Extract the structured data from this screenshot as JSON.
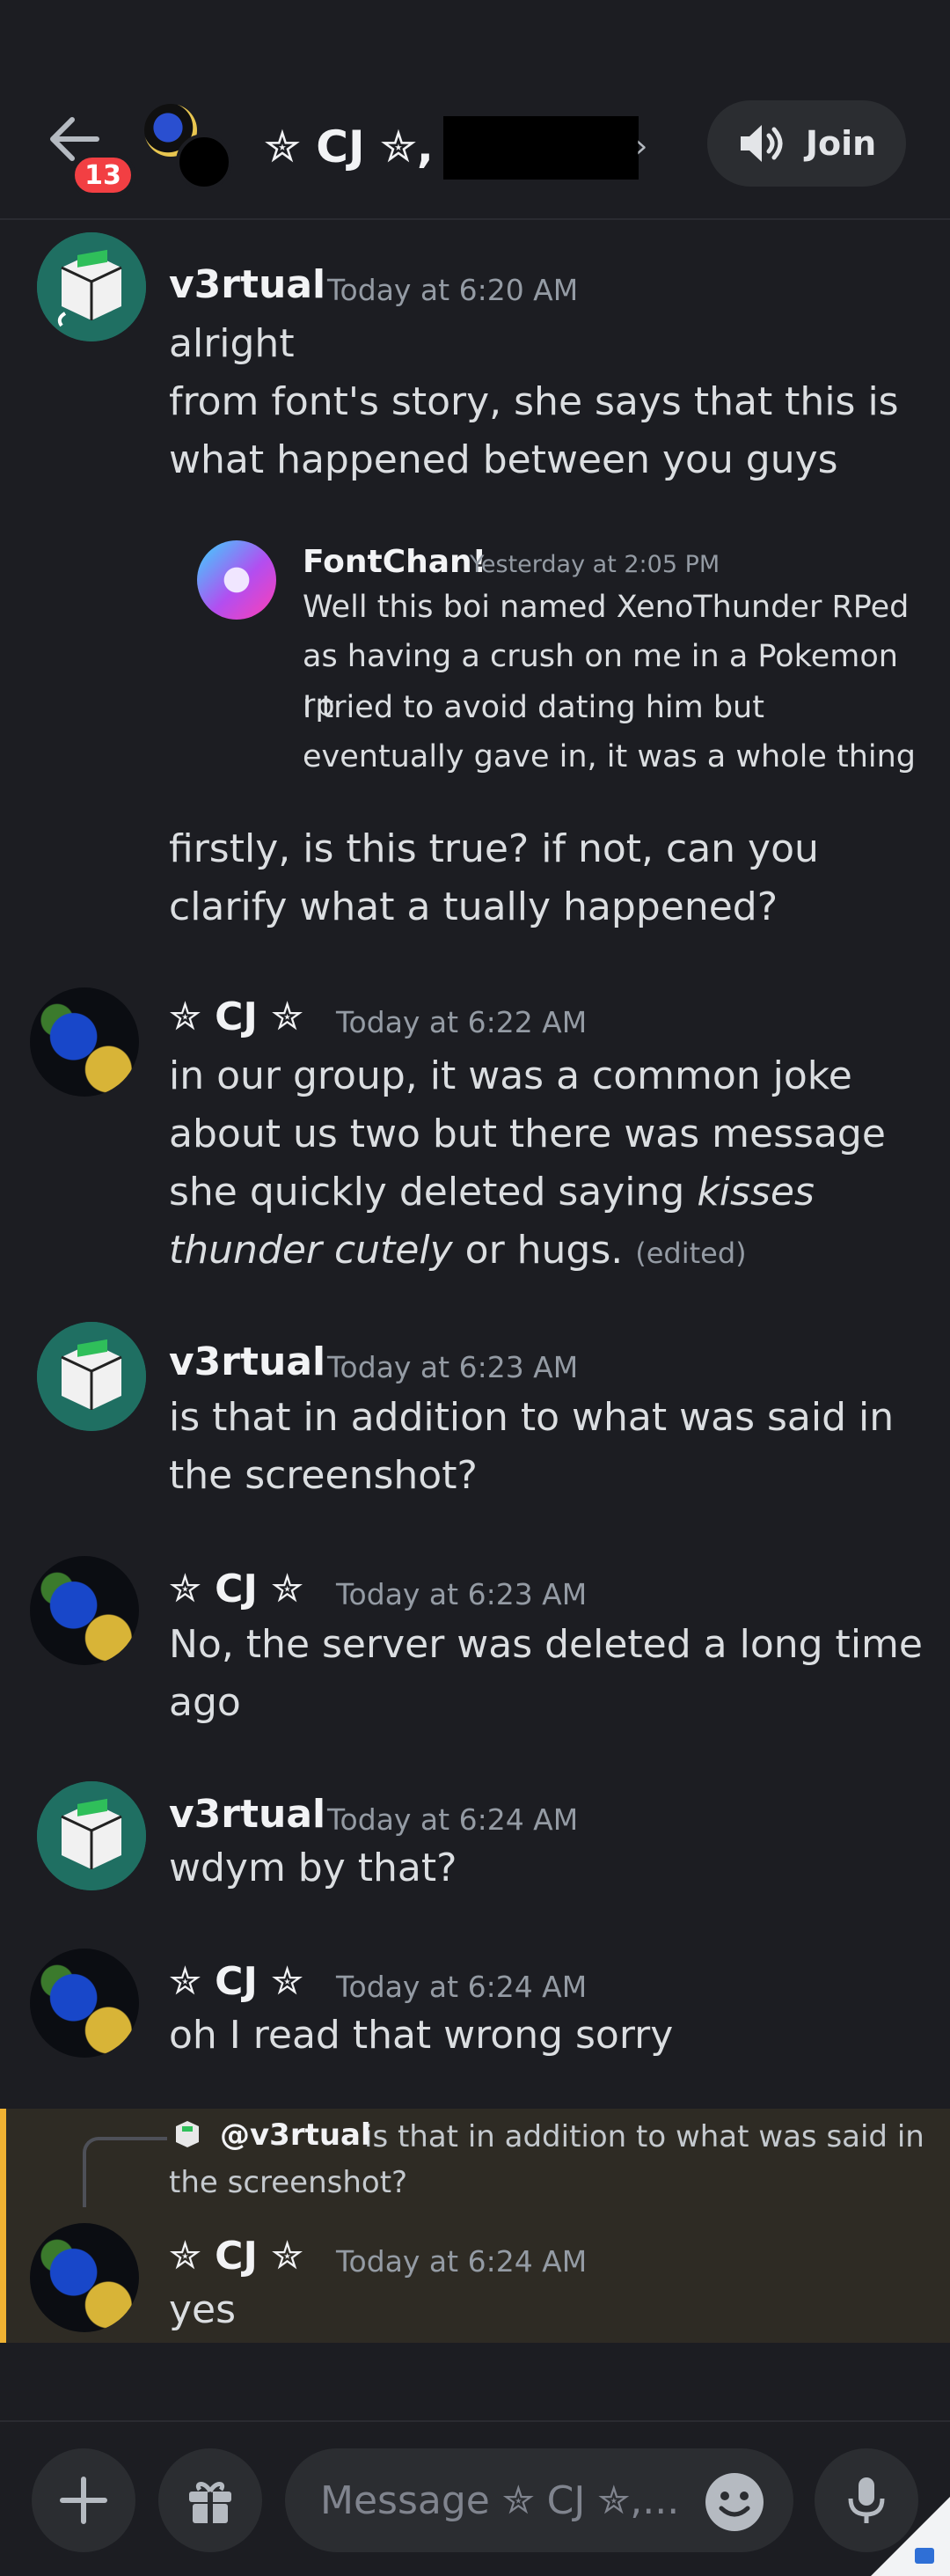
{
  "header": {
    "back_badge": "13",
    "channel_title": "✮ CJ ✮,",
    "chevron": "›",
    "join_label": "Join",
    "icons": [
      "back-arrow-icon",
      "speaker-icon",
      "chevron-right-icon"
    ]
  },
  "messages": [
    {
      "author": "v3rtual",
      "time": "Today at 6:20 AM",
      "lines": [
        "alright",
        "from font's story, she says that this is what happened between you guys"
      ],
      "embed": {
        "author": "FontChan!",
        "time": "Yesterday at 2:05 PM",
        "line1": "Well this boi named XenoThunder RPed as having a crush on me in a Pokemon rp",
        "line2": "I tried to avoid dating him but eventually gave in, it was a whole thing"
      },
      "after": "firstly, is this true? if not, can you clarify what a tually happened?"
    },
    {
      "author": "✮ CJ ✮",
      "time": "Today at 6:22 AM",
      "text_a": "in our group, it was a common joke about us two but there was message she quickly deleted saying ",
      "text_em": "kisses thunder cutely",
      "text_b": " or hugs. ",
      "edited": "(edited)"
    },
    {
      "author": "v3rtual",
      "time": "Today at 6:23 AM",
      "text": "is that in addition to what was said in the screenshot?"
    },
    {
      "author": "✮ CJ ✮",
      "time": "Today at 6:23 AM",
      "text": "No, the server was deleted a long time ago"
    },
    {
      "author": "v3rtual",
      "time": "Today at 6:24 AM",
      "text": "wdym by that?"
    },
    {
      "author": "✮ CJ ✮",
      "time": "Today at 6:24 AM",
      "text": "oh I read that wrong sorry"
    },
    {
      "reply_author": "@v3rtual",
      "reply_preview": "is that in addition to what was said in the screenshot?",
      "author": "✮ CJ ✮",
      "time": "Today at 6:24 AM",
      "text": "yes"
    }
  ],
  "composer": {
    "placeholder": "Message ✮ CJ ✮,..."
  },
  "colors": {
    "background": "#1c1d22",
    "accent_badge": "#f23f43",
    "reply_highlight": "#2e2b24",
    "reply_bar": "#f0b232"
  }
}
